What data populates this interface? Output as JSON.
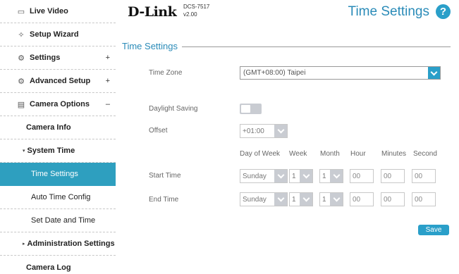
{
  "sidebar": {
    "items": [
      {
        "label": "Live Video",
        "icon": "video-icon",
        "icon_glyph": "▭"
      },
      {
        "label": "Setup Wizard",
        "icon": "wand-icon",
        "icon_glyph": "✧"
      },
      {
        "label": "Settings",
        "icon": "gear-icon",
        "icon_glyph": "⚙",
        "expander": "+"
      },
      {
        "label": "Advanced Setup",
        "icon": "advanced-gear-icon",
        "icon_glyph": "⚙",
        "expander": "+"
      },
      {
        "label": "Camera Options",
        "icon": "camera-options-icon",
        "icon_glyph": "▤",
        "expander": "–"
      },
      {
        "label": "Camera Info"
      },
      {
        "label": "System Time",
        "caret": "▾"
      },
      {
        "label": "Time Settings"
      },
      {
        "label": "Auto Time Config"
      },
      {
        "label": "Set Date and Time"
      },
      {
        "label": "Administration Settings",
        "caret": "▸"
      },
      {
        "label": "Camera Log"
      }
    ]
  },
  "header": {
    "brand": "D-Link",
    "model": "DCS-7517",
    "version": "v2.00",
    "page_title": "Time Settings",
    "help_glyph": "?"
  },
  "section": {
    "title": "Time Settings"
  },
  "form": {
    "time_zone_label": "Time Zone",
    "time_zone_value": "(GMT+08:00) Taipei",
    "daylight_label": "Daylight Saving",
    "offset_label": "Offset",
    "offset_value": "+01:00",
    "columns": [
      "Day of Week",
      "Week",
      "Month",
      "Hour",
      "Minutes",
      "Second"
    ],
    "start": {
      "label": "Start Time",
      "day": "Sunday",
      "week": "1",
      "month": "1",
      "hour": "00",
      "minutes": "00",
      "second": "00"
    },
    "end": {
      "label": "End Time",
      "day": "Sunday",
      "week": "1",
      "month": "1",
      "hour": "00",
      "minutes": "00",
      "second": "00"
    },
    "save_label": "Save"
  },
  "colors": {
    "accent": "#2a9fc9",
    "active_nav": "#2e9fbf",
    "title_blue": "#2a8bb8"
  }
}
